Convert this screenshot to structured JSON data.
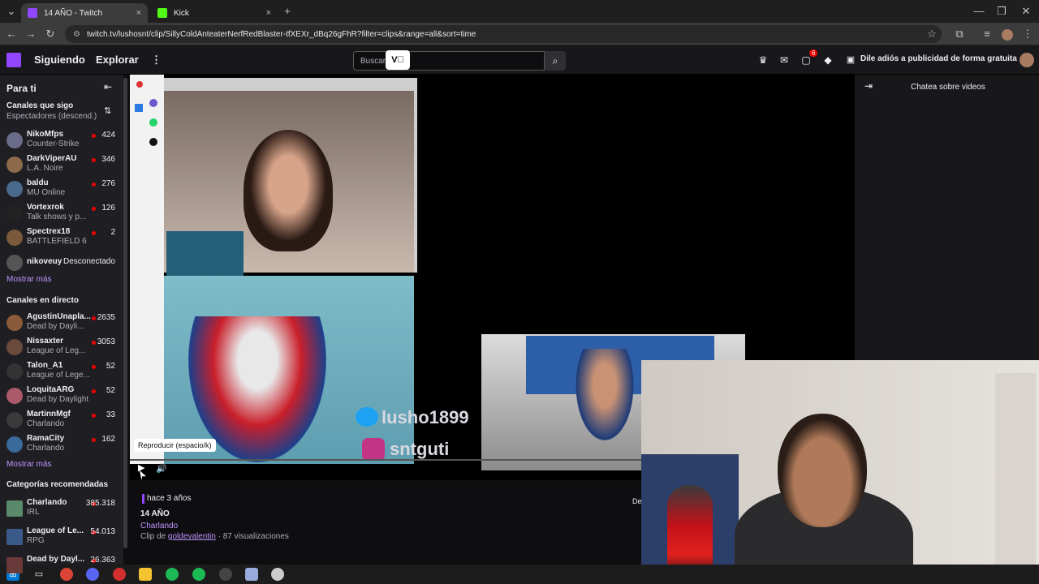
{
  "browser": {
    "tabs": [
      {
        "title": "14 AÑO - Twitch",
        "active": true,
        "color": "#9147ff"
      },
      {
        "title": "Kick",
        "active": false,
        "color": "#53fc18"
      }
    ],
    "new_tab": "+",
    "close": "×",
    "url": "twitch.tv/lushosnt/clip/SillyColdAnteaterNerfRedBlaster-tfXEXr_dBq26gFhR?filter=clips&range=all&sort=time",
    "window_controls": [
      "—",
      "❐",
      "✕"
    ]
  },
  "topnav": {
    "following": "Siguiendo",
    "browse": "Explorar",
    "more": "⋮",
    "search_placeholder": "Buscar",
    "notif_badge": "6",
    "promo": "Dile adiós a publicidad de forma gratuita"
  },
  "sidebar": {
    "for_you": "Para ti",
    "followed_header": "Canales que sigo",
    "followed_sort": "Espectadores (descend.)",
    "followed": [
      {
        "name": "NikoMfps",
        "game": "Counter-Strike",
        "viewers": "424",
        "color": "#6b6b8a"
      },
      {
        "name": "DarkViperAU",
        "game": "L.A. Noire",
        "viewers": "346",
        "color": "#8c6a4a"
      },
      {
        "name": "baldu",
        "game": "MU Online",
        "viewers": "276",
        "color": "#4a6a8c"
      },
      {
        "name": "Vortexrok",
        "game": "Talk shows y p...",
        "viewers": "126",
        "color": "#222222"
      },
      {
        "name": "Spectrex18",
        "game": "BATTLEFIELD 6",
        "viewers": "2",
        "color": "#7a5a3a"
      }
    ],
    "offline": {
      "name": "nikoveuy",
      "status": "Desconectado",
      "color": "#555555"
    },
    "show_more_1": "Mostrar más",
    "live_header": "Canales en directo",
    "live": [
      {
        "name": "AgustinUnapla...",
        "game": "Dead by Dayli...",
        "viewers": "2635",
        "color": "#8a5a3a"
      },
      {
        "name": "Nissaxter",
        "game": "League of Leg...",
        "viewers": "3053",
        "color": "#6a4a3a"
      },
      {
        "name": "Talon_A1",
        "game": "League of Lege...",
        "viewers": "52",
        "color": "#333333"
      },
      {
        "name": "LoquitaARG",
        "game": "Dead by Daylight",
        "viewers": "52",
        "color": "#aa5a6a"
      },
      {
        "name": "MartinnMgf",
        "game": "Charlando",
        "viewers": "33",
        "color": "#3a3a3a"
      },
      {
        "name": "RamaCity",
        "game": "Charlando",
        "viewers": "162",
        "color": "#3a6a9a"
      }
    ],
    "show_more_2": "Mostrar más",
    "rec_header": "Categorías recomendadas",
    "categories": [
      {
        "name": "Charlando",
        "tag": "IRL",
        "viewers": "385.318",
        "color": "#5a8a6a"
      },
      {
        "name": "League of Le...",
        "tag": "RPG",
        "viewers": "54.013",
        "color": "#3a5a8a"
      },
      {
        "name": "Dead by Dayl...",
        "tag": "",
        "viewers": "26.363",
        "color": "#6a3a3a"
      }
    ]
  },
  "player": {
    "overlay_twitter": "lusho1899",
    "overlay_instagram": "sntguti",
    "tooltip": "Reproducir (espacio/k)",
    "play_icon": "▶",
    "volume_icon": "🔊"
  },
  "chat": {
    "title": "Chatea sobre videos",
    "collapse_icon": "⇥"
  },
  "clip": {
    "ago": "hace 3 años",
    "title": "14 AÑO",
    "category": "Charlando",
    "by_prefix": "Clip de",
    "by_user": "goldevalentin",
    "views": " · 87 visualizaciones",
    "trailing": "De"
  }
}
